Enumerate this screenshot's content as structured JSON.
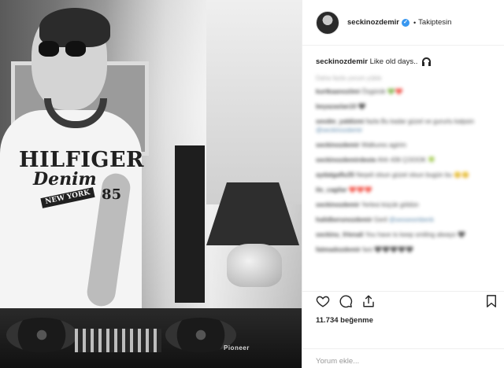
{
  "photo": {
    "shirt_line1": "HILFIGER",
    "shirt_line2": "Denim",
    "shirt_badge": "NEW YORK",
    "shirt_num": "85",
    "mixer_brand": "Pioneer"
  },
  "header": {
    "username": "seckinozdemir",
    "verified_icon": "verified-badge-icon",
    "separator": "•",
    "follow_label": "Takiptesin"
  },
  "caption": {
    "username": "seckinozdemir",
    "text": "Like old days..",
    "emoji_icon": "headphones-icon"
  },
  "comments": [
    {
      "user": "",
      "text": "Daha fazla yorum yükle",
      "muted": true
    },
    {
      "user": "kurtkaanoziimi",
      "text": "Özgürük 💚❤️"
    },
    {
      "user": "beyazaslan10",
      "text": "🖤"
    },
    {
      "user": "sevdm_yaldizmi",
      "text": "fazla Bu kadar güzel ve gururlu kalpsin",
      "tag": "@seckinozdemir"
    },
    {
      "user": "seckinozdemir",
      "text": "Walkures agirim"
    },
    {
      "user": "seckinozdemirdeste",
      "text": "Ahh 436 ÇOOOK 🍀"
    },
    {
      "user": "aydatgaflu35",
      "text": "Neşeli olsun güzel olsun bugün bu 😊😊"
    },
    {
      "user": "ilo_cagilar",
      "text": "❤️❤️❤️"
    },
    {
      "user": "seckinozdemir",
      "text": "Yerlesi küçük göldün"
    },
    {
      "user": "halidberunozdemir",
      "text": "Geril",
      "tag": "@sessesmbenk"
    },
    {
      "user": "seckinu_frlenali",
      "text": "You have to keep smiling always 🖤"
    },
    {
      "user": "fatmadozdemir",
      "text": "fani 🖤🖤🖤🖤🖤"
    }
  ],
  "actions": {
    "like_icon": "heart-icon",
    "comment_icon": "comment-icon",
    "share_icon": "share-icon",
    "save_icon": "bookmark-icon"
  },
  "likes": "11.734 beğenme",
  "add_comment": {
    "placeholder": "Yorum ekle..."
  }
}
